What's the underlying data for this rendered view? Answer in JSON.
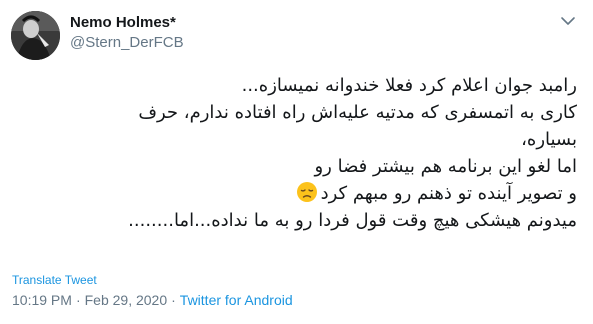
{
  "author": {
    "display_name": "Nemo Holmes*",
    "username": "@Stern_DerFCB",
    "avatar": "avatar-photo"
  },
  "menu_icon": "chevron-down-icon",
  "tweet": {
    "lines": [
      "رامبد جوان اعلام کرد فعلا خندوانه نمیسازه...",
      "کاری به اتمسفری که مدتیه علیه‌اش راه افتاده ندارم، حرف",
      "بسیاره،",
      "اما لغو این برنامه هم بیشتر فضا رو",
      "و تصویر آینده تو ذهنم رو مبهم کرد",
      "میدونم هیشکی هیچ وقت قول فردا رو به ما نداده...اما........"
    ],
    "emoji": "disappointed-face-emoji"
  },
  "translate_label": "Translate Tweet",
  "meta": {
    "time": "10:19 PM",
    "separator": "·",
    "date": "Feb 29, 2020",
    "source": "Twitter for Android"
  },
  "colors": {
    "link": "#1b95e0",
    "secondary": "#657786",
    "text": "#14171a"
  }
}
